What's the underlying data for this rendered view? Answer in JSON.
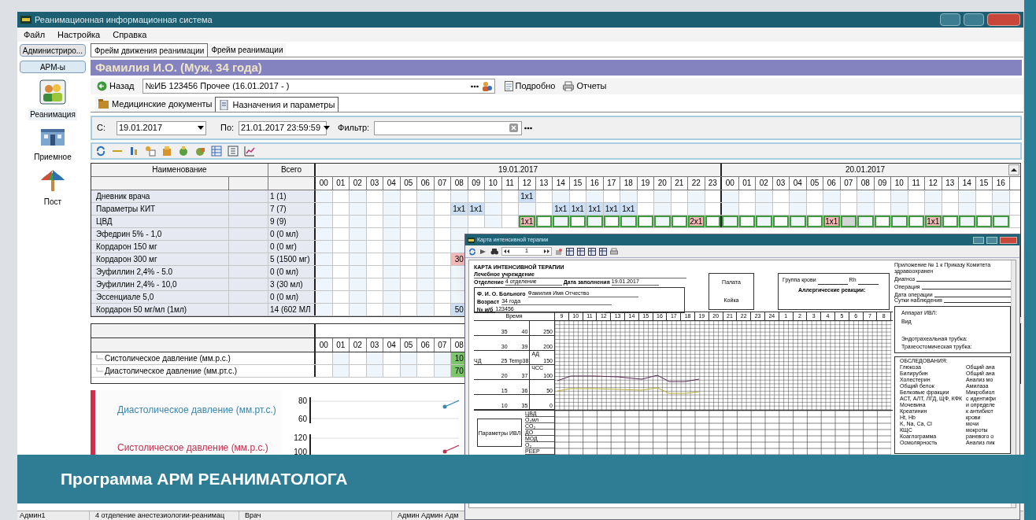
{
  "window": {
    "title": "Реанимационная информационная система"
  },
  "menu": [
    "Файл",
    "Настройка",
    "Справка"
  ],
  "sidebar": {
    "buttons": [
      "Администриро...",
      "АРМ-ы"
    ],
    "items": [
      {
        "label": "Реанимация",
        "selected": true
      },
      {
        "label": "Приемное",
        "selected": false
      },
      {
        "label": "Пост",
        "selected": false
      }
    ]
  },
  "tabs": [
    {
      "label": "Фрейм движения реанимации",
      "selected": true
    },
    {
      "label": "Фрейм реанимации",
      "selected": false
    }
  ],
  "patient": {
    "header": "Фамилия И.О. (Муж, 34 года)"
  },
  "toolbar": {
    "back": "Назад",
    "case_field": "№ИБ 123456 Прочее (16.01.2017 - )",
    "details": "Подробно",
    "reports": "Отчеты"
  },
  "subtabs": [
    {
      "label": "Медицинские документы",
      "selected": false
    },
    {
      "label": "Назначения и параметры",
      "selected": true
    }
  ],
  "filter": {
    "from_label": "С:",
    "from": "19.01.2017",
    "to_label": "По:",
    "to": "21.01.2017 23:59:59",
    "filter_label": "Фильтр:"
  },
  "prescriptions": {
    "columns": [
      "Наименование",
      "Всего"
    ],
    "days": [
      "19.01.2017",
      "20.01.2017"
    ],
    "hours": [
      "00",
      "01",
      "02",
      "03",
      "04",
      "05",
      "06",
      "07",
      "08",
      "09",
      "10",
      "11",
      "12",
      "13",
      "14",
      "15",
      "16",
      "17",
      "18",
      "19",
      "20",
      "21",
      "22",
      "23",
      "00",
      "01",
      "02",
      "03",
      "04",
      "05",
      "06",
      "07",
      "08",
      "09",
      "10",
      "11",
      "12",
      "13",
      "14",
      "15",
      "16"
    ],
    "rows": [
      {
        "name": "Дневник врача",
        "total": "1 (1)",
        "cells": [
          {
            "kind": "plain"
          },
          {
            "kind": "plain"
          },
          {
            "kind": "plain"
          },
          {
            "kind": "plain"
          },
          {
            "kind": "plain"
          },
          {
            "kind": "plain"
          },
          {
            "kind": "plain"
          },
          {
            "kind": "plain"
          },
          {
            "kind": "plain"
          },
          {
            "kind": "plain"
          },
          {
            "kind": "plain"
          },
          {
            "kind": "plain"
          },
          {
            "kind": "given",
            "text": "1x1"
          },
          {
            "kind": "plain"
          },
          {
            "kind": "plain"
          },
          {
            "kind": "plain"
          },
          {
            "kind": "plain"
          },
          {
            "kind": "plain"
          },
          {
            "kind": "plain"
          },
          {
            "kind": "plain"
          },
          {
            "kind": "plain"
          },
          {
            "kind": "plain"
          },
          {
            "kind": "plain"
          },
          {
            "kind": "plain"
          },
          {
            "kind": "plain"
          },
          {
            "kind": "plain"
          },
          {
            "kind": "plain"
          },
          {
            "kind": "plain"
          },
          {
            "kind": "plain"
          },
          {
            "kind": "plain"
          },
          {
            "kind": "plain"
          },
          {
            "kind": "plain"
          },
          {
            "kind": "plain"
          },
          {
            "kind": "plain"
          },
          {
            "kind": "plain"
          },
          {
            "kind": "plain"
          },
          {
            "kind": "plain"
          },
          {
            "kind": "plain"
          },
          {
            "kind": "plain"
          },
          {
            "kind": "plain"
          },
          {
            "kind": "plain"
          }
        ]
      },
      {
        "name": "Параметры КИТ",
        "total": "7 (7)",
        "cells": [
          {
            "kind": "plain"
          },
          {
            "kind": "plain"
          },
          {
            "kind": "plain"
          },
          {
            "kind": "plain"
          },
          {
            "kind": "plain"
          },
          {
            "kind": "plain"
          },
          {
            "kind": "plain"
          },
          {
            "kind": "plain"
          },
          {
            "kind": "given",
            "text": "1x1"
          },
          {
            "kind": "given",
            "text": "1x1"
          },
          {
            "kind": "plain"
          },
          {
            "kind": "plain"
          },
          {
            "kind": "plain"
          },
          {
            "kind": "plain"
          },
          {
            "kind": "given",
            "text": "1x1"
          },
          {
            "kind": "given",
            "text": "1x1"
          },
          {
            "kind": "given",
            "text": "1x1"
          },
          {
            "kind": "given",
            "text": "1x1"
          },
          {
            "kind": "given",
            "text": "1x1"
          },
          {
            "kind": "plain"
          },
          {
            "kind": "plain"
          },
          {
            "kind": "plain"
          },
          {
            "kind": "plain"
          },
          {
            "kind": "plain"
          },
          {
            "kind": "plain"
          },
          {
            "kind": "plain"
          },
          {
            "kind": "plain"
          },
          {
            "kind": "plain"
          },
          {
            "kind": "plain"
          },
          {
            "kind": "plain"
          },
          {
            "kind": "plain"
          },
          {
            "kind": "plain"
          },
          {
            "kind": "plain"
          },
          {
            "kind": "plain"
          },
          {
            "kind": "plain"
          },
          {
            "kind": "plain"
          },
          {
            "kind": "plain"
          },
          {
            "kind": "plain"
          },
          {
            "kind": "plain"
          },
          {
            "kind": "plain"
          },
          {
            "kind": "plain"
          }
        ]
      },
      {
        "name": "ЦВД",
        "total": "9 (9)",
        "cells": [
          {
            "kind": "plain"
          },
          {
            "kind": "plain"
          },
          {
            "kind": "plain"
          },
          {
            "kind": "plain"
          },
          {
            "kind": "plain"
          },
          {
            "kind": "plain"
          },
          {
            "kind": "plain"
          },
          {
            "kind": "plain"
          },
          {
            "kind": "plain"
          },
          {
            "kind": "plain"
          },
          {
            "kind": "plain"
          },
          {
            "kind": "plain"
          },
          {
            "kind": "due",
            "text": "1x1"
          },
          {
            "kind": "scheduled"
          },
          {
            "kind": "scheduled"
          },
          {
            "kind": "scheduled"
          },
          {
            "kind": "scheduled"
          },
          {
            "kind": "scheduled"
          },
          {
            "kind": "scheduled"
          },
          {
            "kind": "scheduled"
          },
          {
            "kind": "scheduled"
          },
          {
            "kind": "scheduled"
          },
          {
            "kind": "due",
            "text": "2x1"
          },
          {
            "kind": "scheduled"
          },
          {
            "kind": "scheduled"
          },
          {
            "kind": "scheduled"
          },
          {
            "kind": "scheduled"
          },
          {
            "kind": "scheduled"
          },
          {
            "kind": "scheduled"
          },
          {
            "kind": "scheduled"
          },
          {
            "kind": "due",
            "text": "1x1"
          },
          {
            "kind": "missed"
          },
          {
            "kind": "scheduled"
          },
          {
            "kind": "scheduled"
          },
          {
            "kind": "scheduled"
          },
          {
            "kind": "scheduled"
          },
          {
            "kind": "due",
            "text": "1x1"
          },
          {
            "kind": "scheduled"
          },
          {
            "kind": "scheduled"
          },
          {
            "kind": "scheduled"
          },
          {
            "kind": "scheduled"
          }
        ]
      },
      {
        "name": "Эфедрин 5% - 1,0",
        "total": "0 (0 мл)",
        "cells": [
          {
            "kind": "plain"
          },
          {
            "kind": "plain"
          },
          {
            "kind": "plain"
          },
          {
            "kind": "plain"
          },
          {
            "kind": "plain"
          },
          {
            "kind": "plain"
          },
          {
            "kind": "plain"
          },
          {
            "kind": "plain"
          },
          {
            "kind": "plain"
          }
        ]
      },
      {
        "name": "Кордарон 150 мг",
        "total": "0 (0 мг)",
        "cells": [
          {
            "kind": "plain"
          },
          {
            "kind": "plain"
          },
          {
            "kind": "plain"
          },
          {
            "kind": "plain"
          },
          {
            "kind": "plain"
          },
          {
            "kind": "plain"
          },
          {
            "kind": "plain"
          },
          {
            "kind": "plain"
          },
          {
            "kind": "plain"
          }
        ]
      },
      {
        "name": "Кордарон 300 мг",
        "total": "5 (1500 мг)",
        "cells": [
          {
            "kind": "plain"
          },
          {
            "kind": "plain"
          },
          {
            "kind": "plain"
          },
          {
            "kind": "plain"
          },
          {
            "kind": "plain"
          },
          {
            "kind": "plain"
          },
          {
            "kind": "plain"
          },
          {
            "kind": "plain"
          },
          {
            "kind": "pending",
            "text": "30"
          }
        ]
      },
      {
        "name": "Эуфиллин 2,4% - 5.0",
        "total": "0 (0 мл)",
        "cells": [
          {
            "kind": "plain"
          },
          {
            "kind": "plain"
          },
          {
            "kind": "plain"
          },
          {
            "kind": "plain"
          },
          {
            "kind": "plain"
          },
          {
            "kind": "plain"
          },
          {
            "kind": "plain"
          },
          {
            "kind": "plain"
          },
          {
            "kind": "plain"
          }
        ]
      },
      {
        "name": "Эуфиллин 2,4% - 10,0",
        "total": "3 (30 мл)",
        "cells": [
          {
            "kind": "plain"
          },
          {
            "kind": "plain"
          },
          {
            "kind": "plain"
          },
          {
            "kind": "plain"
          },
          {
            "kind": "plain"
          },
          {
            "kind": "plain"
          },
          {
            "kind": "plain"
          },
          {
            "kind": "plain"
          },
          {
            "kind": "plain"
          }
        ]
      },
      {
        "name": "Эссенциале 5,0",
        "total": "0 (0 мл)",
        "cells": [
          {
            "kind": "plain"
          },
          {
            "kind": "plain"
          },
          {
            "kind": "plain"
          },
          {
            "kind": "plain"
          },
          {
            "kind": "plain"
          },
          {
            "kind": "plain"
          },
          {
            "kind": "plain"
          },
          {
            "kind": "plain"
          },
          {
            "kind": "plain"
          }
        ]
      },
      {
        "name": "Кордарон 50 мг/мл (1мл)",
        "total": "14 (602 МЛ",
        "cells": [
          {
            "kind": "plain"
          },
          {
            "kind": "plain"
          },
          {
            "kind": "plain"
          },
          {
            "kind": "plain"
          },
          {
            "kind": "plain"
          },
          {
            "kind": "plain"
          },
          {
            "kind": "plain"
          },
          {
            "kind": "plain"
          },
          {
            "kind": "given",
            "text": "50"
          }
        ]
      }
    ]
  },
  "parameters": {
    "hours": [
      "00",
      "01",
      "02",
      "03",
      "04",
      "05",
      "06",
      "07",
      "08"
    ],
    "rows": [
      {
        "name": "Систолическое давление (мм.р.с.)",
        "cells": [
          {
            "kind": "plain"
          },
          {
            "kind": "plain"
          },
          {
            "kind": "plain"
          },
          {
            "kind": "plain"
          },
          {
            "kind": "plain"
          },
          {
            "kind": "plain"
          },
          {
            "kind": "plain"
          },
          {
            "kind": "plain"
          },
          {
            "kind": "measured",
            "text": "10"
          }
        ]
      },
      {
        "name": "Диастолическое давление (мм.рт.с.)",
        "cells": [
          {
            "kind": "plain"
          },
          {
            "kind": "plain"
          },
          {
            "kind": "plain"
          },
          {
            "kind": "plain"
          },
          {
            "kind": "plain"
          },
          {
            "kind": "plain"
          },
          {
            "kind": "plain"
          },
          {
            "kind": "plain"
          },
          {
            "kind": "measured",
            "text": "70"
          }
        ]
      }
    ]
  },
  "charts": [
    {
      "legend": "Диастолическое давление (мм.рт.с.)",
      "color": "#3a86b0",
      "ticks": [
        "80",
        "60"
      ]
    },
    {
      "legend": "Систолическое давление (мм.р.с.)",
      "color": "#c0304f",
      "ticks": [
        "120",
        "100"
      ]
    }
  ],
  "card_window": {
    "title": "Карта интенсивной терапии",
    "page": "1",
    "heading": "КАРТА ИНТЕНСИВНОЙ ТЕРАПИИ",
    "institution": "Лечебное учреждение",
    "department": {
      "label": "Отделение",
      "value": "4 отделение"
    },
    "fill_date": {
      "label": "Дата заполнения",
      "value": "19.01.2017"
    },
    "patient_fields": [
      {
        "label": "Ф. И. О. Больного",
        "value": "Фамилия Имя Отчество"
      },
      {
        "label": "Возраст",
        "value": "34 года"
      },
      {
        "label": "№ и/б",
        "value": "123456"
      }
    ],
    "ward_box": [
      "Палата",
      "Койка"
    ],
    "blood": {
      "group": "Группа крови",
      "rh": "Rh",
      "allergy": "Аллергические реакции:"
    },
    "order_note": "Приложение № 1 к Приказу Комитета здравоохранен",
    "right_fields": [
      "Диагноз",
      "Операция",
      "Дата операции",
      "Сутки наблюдения"
    ],
    "ventilator_box": [
      "Аппарат ИВЛ:",
      "Вид",
      "Эндотрахеальная трубка:",
      "Трахеостомическая трубка:"
    ],
    "exams": {
      "title": "ОБСЛЕДОВАНИЯ:",
      "left": [
        "Глюкоза",
        "Билирубин",
        "Холестерин",
        "Общий белок",
        "Белковые фракции",
        "АСТ, АЛТ, ЛГД, ЩФ, КФК",
        "Мочевина",
        "Креатинин",
        "Ht, Hb",
        "K, Na, Ca, Cl",
        "КЩС",
        "Коаглограмма",
        "Осмолярность"
      ],
      "right": [
        "Общий ана",
        "Общий ана",
        "Анализ мо",
        "Амилаза",
        "Микробиол",
        "с идентифи",
        "и определе",
        "к антибиот",
        "крови",
        "мочи",
        "мокроты",
        "раневого о",
        "Анализ лик"
      ]
    },
    "time_label": "Время",
    "hours": [
      "9",
      "10",
      "11",
      "12",
      "13",
      "14",
      "15",
      "16",
      "17",
      "18",
      "19",
      "20",
      "21",
      "22",
      "23",
      "24",
      "1",
      "2",
      "3",
      "4",
      "5",
      "6",
      "7",
      "8"
    ],
    "scale_rows": [
      {
        "rr": "35",
        "temp": "40",
        "bp": "250"
      },
      {
        "rr": "30",
        "temp": "39",
        "bp": "200"
      },
      {
        "rr": "25",
        "temp": "38",
        "bp": "150"
      },
      {
        "rr": "20",
        "temp": "37",
        "bp": "100"
      },
      {
        "rr": "15",
        "temp": "36",
        "bp": "50"
      },
      {
        "rr": "10",
        "temp": "35",
        "bp": "0"
      }
    ],
    "axis_titles": {
      "rr": "ЧД",
      "temp": "Temp",
      "bp": "АД",
      "hr": "ЧСС"
    },
    "vent_box": "Параметры ИВЛ",
    "vent_labels": [
      "ЦВД",
      "O₂мл",
      "CO₂",
      "ДО",
      "МОД",
      "O₂",
      "PEEP"
    ]
  },
  "banner": "Программа АРМ РЕАНИМАТОЛОГА",
  "status_bar": [
    "Админ1",
    "4 отделение анестезиологии-реанимац",
    "Врач",
    "Админ Админ Адм"
  ]
}
